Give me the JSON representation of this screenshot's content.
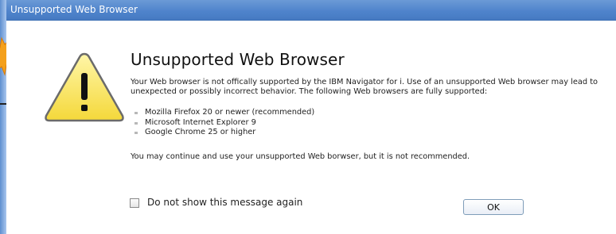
{
  "window": {
    "title": "Unsupported Web Browser"
  },
  "dialog": {
    "heading": "Unsupported Web Browser",
    "message": "Your Web browser is not offically supported by the IBM Navigator for i. Use of an unsupported Web browser may lead to unexpected or possibly incorrect behavior. The following Web browsers are fully supported:",
    "supported_browsers": [
      "Mozilla Firefox 20 or newer (recommended)",
      "Microsoft Internet Explorer 9",
      "Google Chrome 25 or higher"
    ],
    "continue_note": "You may continue and use your unsupported Web borwser, but it is not recommended.",
    "checkbox": {
      "label": "Do not show this message again",
      "checked": false
    },
    "ok_label": "OK"
  },
  "icons": {
    "warning": "warning-triangle-icon"
  },
  "colors": {
    "titlebar": "#4f84cc",
    "warning_fill": "#fbe96a",
    "warning_stroke": "#6b6b6b"
  }
}
